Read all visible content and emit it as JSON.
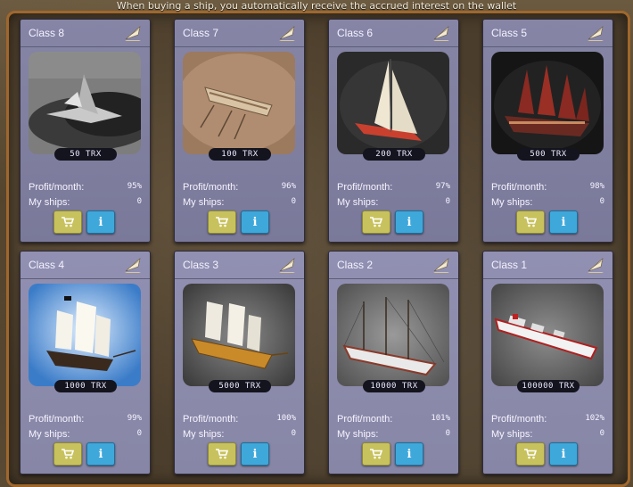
{
  "notice": "When buying a ship, you automatically receive the accrued interest on the wallet",
  "labels": {
    "profit": "Profit/month:",
    "ships": "My ships:"
  },
  "info_glyph": "i",
  "icons": {
    "header": "sail-icon",
    "buy": "cart-icon",
    "info": "info-icon"
  },
  "colors": {
    "card": "#8685a6",
    "buy_button": "#c8c25e",
    "info_button": "#3fa8da",
    "frame": "#a0672c",
    "price_badge": "#14141e"
  },
  "cards": [
    {
      "class": "Class 8",
      "price": "50 TRX",
      "profit": "95%",
      "ships": "0"
    },
    {
      "class": "Class 7",
      "price": "100 TRX",
      "profit": "96%",
      "ships": "0"
    },
    {
      "class": "Class 6",
      "price": "200 TRX",
      "profit": "97%",
      "ships": "0"
    },
    {
      "class": "Class 5",
      "price": "500 TRX",
      "profit": "98%",
      "ships": "0"
    },
    {
      "class": "Class 4",
      "price": "1000 TRX",
      "profit": "99%",
      "ships": "0"
    },
    {
      "class": "Class 3",
      "price": "5000 TRX",
      "profit": "100%",
      "ships": "0"
    },
    {
      "class": "Class 2",
      "price": "10000 TRX",
      "profit": "101%",
      "ships": "0"
    },
    {
      "class": "Class 1",
      "price": "100000 TRX",
      "profit": "102%",
      "ships": "0"
    }
  ]
}
